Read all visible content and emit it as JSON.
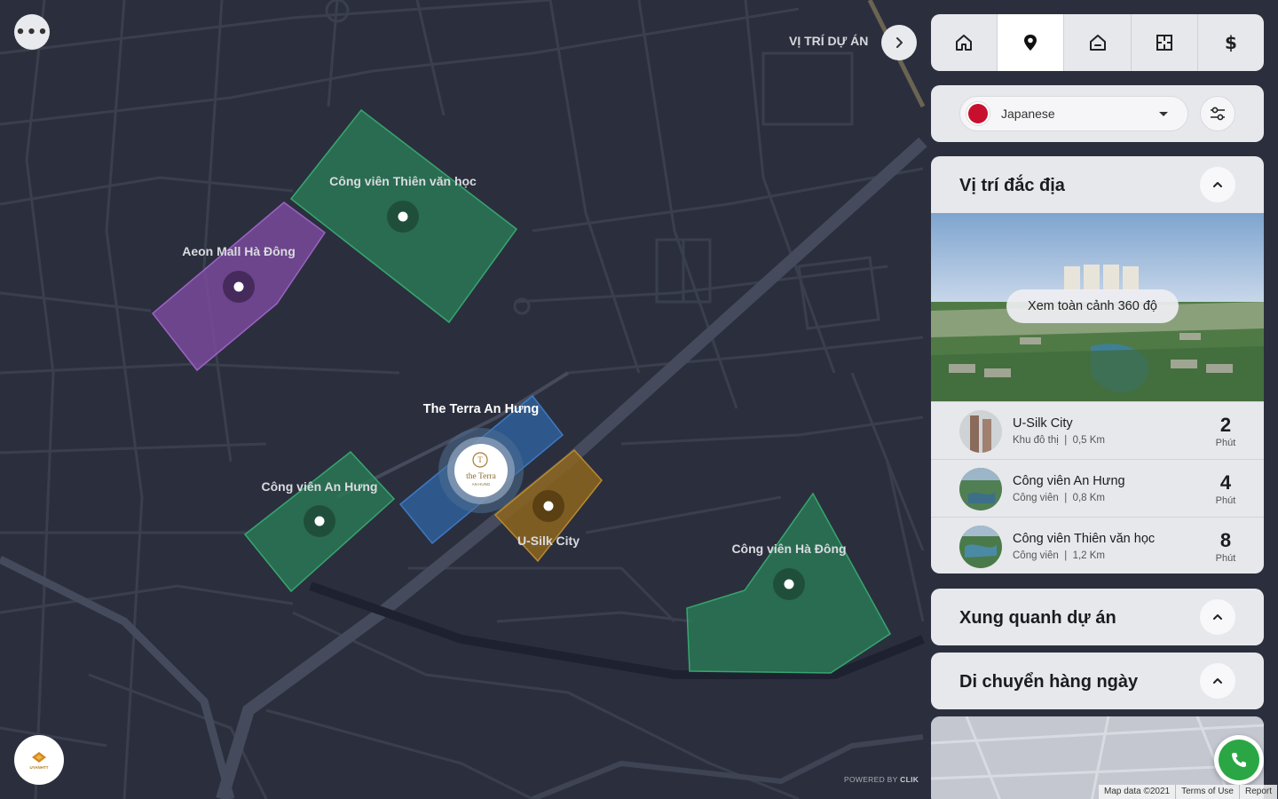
{
  "map": {
    "labels": {
      "thien_van_hoc": "Công viên Thiên văn học",
      "aeon": "Aeon Mall Hà Đông",
      "terra": "The Terra An Hưng",
      "an_hung": "Công viên An Hưng",
      "usilk": "U-Silk City",
      "ha_dong": "Công viên Hà Đông"
    },
    "center_logo": {
      "line1": "the Terra",
      "line2": "AN HUNG"
    },
    "zone_colors": {
      "park": "#2b7a55",
      "mall": "#7c4a9e",
      "project": "#2f5f99",
      "urban": "#8a6420"
    }
  },
  "top_left": {
    "menu_icon": "more-dots-icon",
    "menu_label": "•••"
  },
  "location": {
    "title": "VỊ TRÍ DỰ ÁN",
    "next_icon": "chevron-right-icon"
  },
  "tabs": [
    {
      "name": "home",
      "icon": "home-icon",
      "active": false
    },
    {
      "name": "location",
      "icon": "map-pin-icon",
      "active": true
    },
    {
      "name": "house",
      "icon": "house-icon",
      "active": false
    },
    {
      "name": "floorplan",
      "icon": "floorplan-icon",
      "active": false
    },
    {
      "name": "price",
      "icon": "dollar-icon",
      "active": false,
      "glyph": "$"
    }
  ],
  "language": {
    "selected": "Japanese",
    "flag": "japan-flag-icon"
  },
  "vi_tri": {
    "title": "Vị trí đắc địa",
    "pano_label": "Xem toàn cảnh 360 độ",
    "places": [
      {
        "name": "U-Silk City",
        "type": "Khu đô thị",
        "distance": "0,5 Km",
        "minutes": "2",
        "unit": "Phút"
      },
      {
        "name": "Công viên An Hưng",
        "type": "Công viên",
        "distance": "0,8 Km",
        "minutes": "4",
        "unit": "Phút"
      },
      {
        "name": "Công viên Thiên văn học",
        "type": "Công viên",
        "distance": "1,2 Km",
        "minutes": "8",
        "unit": "Phút"
      }
    ],
    "separator": "|"
  },
  "xung_quanh": {
    "title": "Xung quanh dự án"
  },
  "di_chuyen": {
    "title": "Di chuyển hàng ngày"
  },
  "footer": {
    "powered_prefix": "POWERED BY",
    "powered_brand": "CLIK",
    "attribution": [
      "Map data ©2021",
      "Terms of Use",
      "Report"
    ],
    "logo_text": "UYANHTT"
  },
  "accent": {
    "phone": "#2aa744",
    "flag_red": "#c8102e"
  }
}
